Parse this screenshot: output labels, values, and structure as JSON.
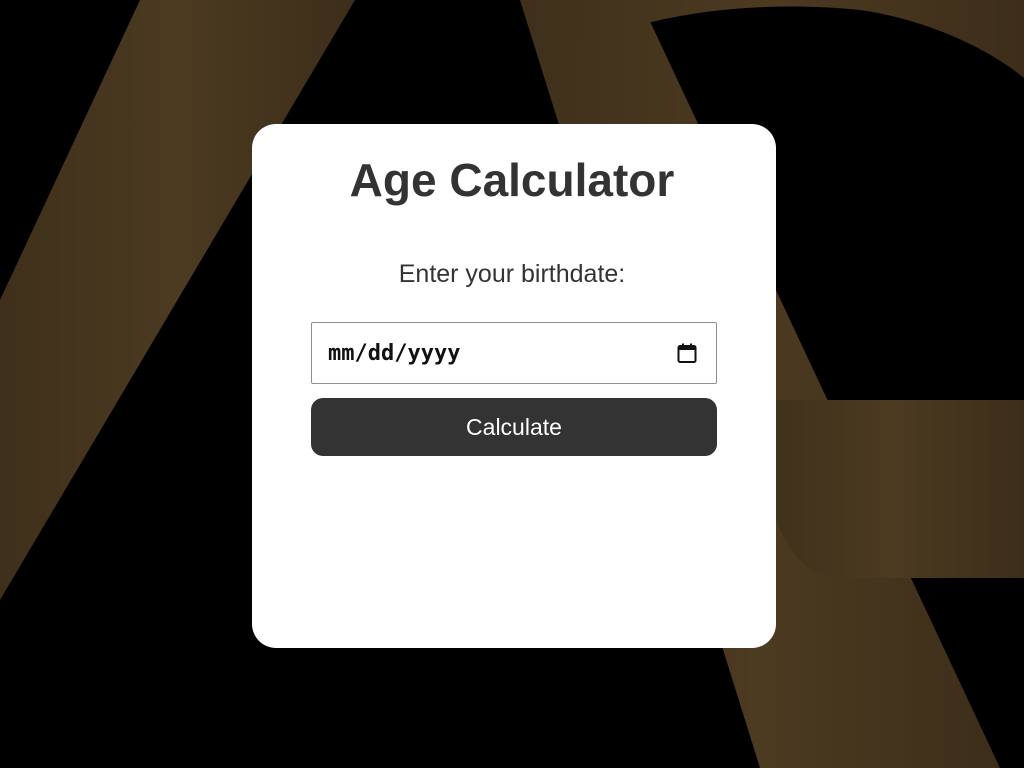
{
  "app": {
    "title": "Age Calculator",
    "prompt": "Enter your birthdate:"
  },
  "date_input": {
    "placeholder": "mm/dd/yyyy",
    "value": "",
    "icon": "calendar-icon"
  },
  "actions": {
    "calculate_label": "Calculate"
  },
  "result": {
    "text": ""
  },
  "colors": {
    "background": "#000000",
    "background_accent": "#4a3820",
    "card": "#ffffff",
    "text": "#333333",
    "button": "#333333",
    "button_text": "#ffffff"
  }
}
